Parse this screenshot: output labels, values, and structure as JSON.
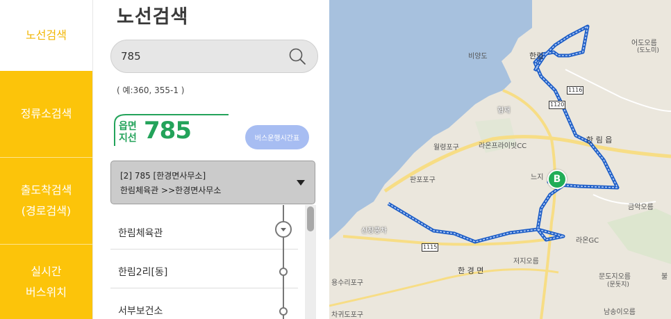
{
  "nav": {
    "items": [
      {
        "label": "노선검색"
      },
      {
        "label": "정류소검색"
      },
      {
        "label": "출도착검색\n(경로검색)"
      },
      {
        "label": "실시간\n버스위치"
      }
    ]
  },
  "panel": {
    "title": "노선검색",
    "search": {
      "value": "785",
      "hint": "( 예:360, 355-1 )"
    },
    "route_badge": {
      "type": "읍면\n지선",
      "number": "785"
    },
    "timetable_label": "버스운행시간표",
    "route_select": {
      "line1": "[2] 785 [한경면사무소]",
      "line2": "한림체육관 >>한경면사무소"
    },
    "stops": [
      {
        "name": "한림체육관"
      },
      {
        "name": "한림2리[동]"
      },
      {
        "name": "서부보건소"
      }
    ]
  },
  "map": {
    "labels": {
      "biyangdo": "비양도",
      "hallim": "한림",
      "hyeopjae": "협재",
      "ongpo": "월령포구",
      "laon_cc": "라온프라이빗CC",
      "panpo": "판포포구",
      "sinchang": "신창풍차",
      "hallim_eup": "한 림 읍",
      "neuji": "느지",
      "geumak": "금악오름",
      "laon_gc": "라온GC",
      "jeoji": "저지오름",
      "hangyeong": "한 경 면",
      "yongsu": "용수리포구",
      "chagwido": "차귀도포구",
      "mundoji": "문도지오름",
      "mundoji_sub": "(문돗지)",
      "namsongi": "남송이오름",
      "eodo": "어도오름",
      "eodo_sub": "(도노미)",
      "bul": "불"
    },
    "roads": {
      "r1116": "1116",
      "r1115": "1115",
      "r1120": "1120"
    },
    "bus_marker": "B",
    "colors": {
      "route": "#3d7ae0",
      "sea": "#a7c1de",
      "land": "#ebe7dd",
      "road": "#f7dd85"
    }
  }
}
